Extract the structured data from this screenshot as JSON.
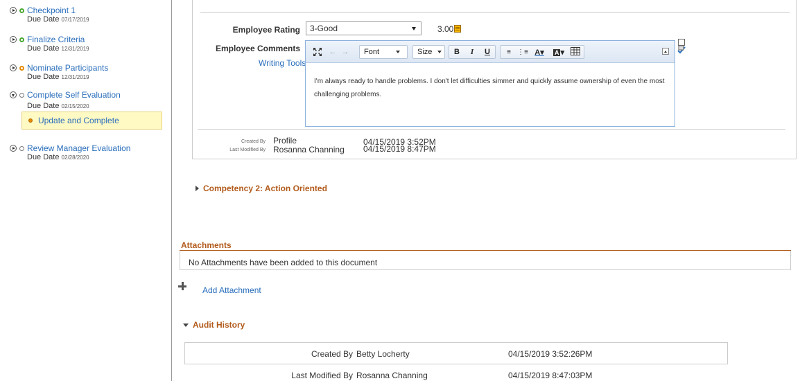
{
  "sidebar": {
    "steps": [
      {
        "title": "Checkpoint 1",
        "due_label": "Due Date",
        "due_date": "07/17/2019"
      },
      {
        "title": "Finalize Criteria",
        "due_label": "Due Date",
        "due_date": "12/31/2019"
      },
      {
        "title": "Nominate Participants",
        "due_label": "Due Date",
        "due_date": "12/31/2019"
      },
      {
        "title": "Complete Self Evaluation",
        "due_label": "Due Date",
        "due_date": "02/15/2020"
      },
      {
        "title": "Review Manager Evaluation",
        "due_label": "Due Date",
        "due_date": "02/28/2020"
      }
    ],
    "active_sub_item": "Update and Complete"
  },
  "rating": {
    "label": "Employee Rating",
    "selected": "3-Good",
    "score": "3.00"
  },
  "comments": {
    "label": "Employee Comments",
    "writing_tools": "Writing Tools",
    "toolbar": {
      "font": "Font",
      "size": "Size",
      "bold": "B",
      "italic": "I",
      "underline": "U"
    },
    "text": "I'm always ready to handle problems. I don't let difficulties simmer and quickly assume ownership of even the most challenging problems."
  },
  "item_meta": {
    "created_by_label": "Created By",
    "created_by": "Profile",
    "created_at": "04/15/2019  3:52PM",
    "modified_by_label": "Last Modified By",
    "modified_by": "Rosanna Channing",
    "modified_at": "04/15/2019  8:47PM"
  },
  "competency2": {
    "title": "Competency 2: Action Oriented"
  },
  "attachments": {
    "title": "Attachments",
    "empty_message": "No Attachments have been added to this document",
    "add_label": "Add Attachment"
  },
  "audit": {
    "title": "Audit History",
    "created_by_label": "Created By",
    "created_by": "Betty Locherty",
    "created_at": "04/15/2019  3:52:26PM",
    "modified_by_label": "Last Modified By",
    "modified_by": "Rosanna Channing",
    "modified_at": "04/15/2019  8:47:03PM"
  },
  "colors": {
    "link": "#2a6ebb",
    "section": "#b25b1c",
    "highlight": "#fff9c4"
  }
}
